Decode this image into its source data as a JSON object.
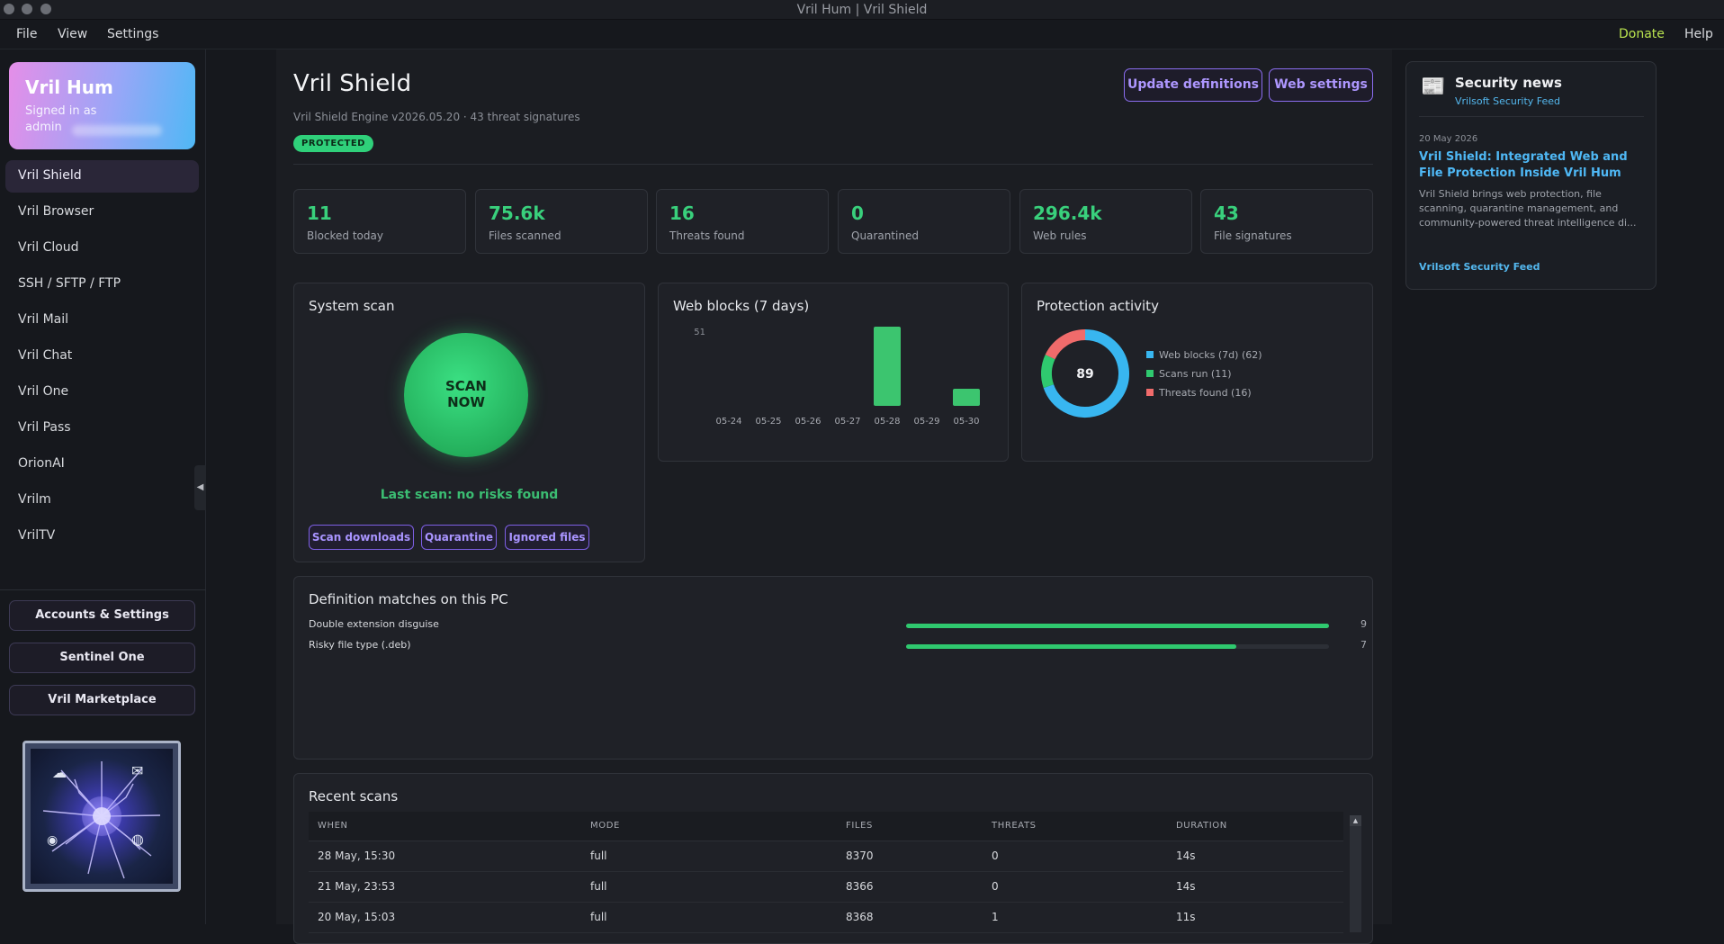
{
  "window": {
    "title": "Vril Hum | Vril Shield"
  },
  "menubar": {
    "file": "File",
    "view": "View",
    "settings": "Settings",
    "donate": "Donate",
    "help": "Help"
  },
  "profile": {
    "name": "Vril Hum",
    "signed_in": "Signed in as admin"
  },
  "sidebar": {
    "items": [
      {
        "label": "Vril Shield"
      },
      {
        "label": "Vril Browser"
      },
      {
        "label": "Vril Cloud"
      },
      {
        "label": "SSH / SFTP / FTP"
      },
      {
        "label": "Vril Mail"
      },
      {
        "label": "Vril Chat"
      },
      {
        "label": "Vril One"
      },
      {
        "label": "Vril Pass"
      },
      {
        "label": "OrionAI"
      },
      {
        "label": "Vrilm"
      },
      {
        "label": "VrilTV"
      }
    ],
    "buttons": {
      "accounts": "Accounts & Settings",
      "sentinel": "Sentinel One",
      "marketplace": "Vril Marketplace"
    }
  },
  "header": {
    "title": "Vril Shield",
    "engine": "Vril Shield Engine v2026.05.20 · 43 threat signatures",
    "status": "PROTECTED",
    "update_btn": "Update definitions",
    "web_btn": "Web settings"
  },
  "stats": [
    {
      "value": "11",
      "label": "Blocked today"
    },
    {
      "value": "75.6k",
      "label": "Files scanned"
    },
    {
      "value": "16",
      "label": "Threats found"
    },
    {
      "value": "0",
      "label": "Quarantined"
    },
    {
      "value": "296.4k",
      "label": "Web rules"
    },
    {
      "value": "43",
      "label": "File signatures"
    }
  ],
  "system_scan": {
    "title": "System scan",
    "scan_line1": "SCAN",
    "scan_line2": "NOW",
    "last_scan": "Last scan: no risks found",
    "scan_downloads": "Scan downloads",
    "quarantine": "Quarantine",
    "ignored": "Ignored files"
  },
  "web_blocks": {
    "title": "Web blocks (7 days)"
  },
  "protection": {
    "title": "Protection activity",
    "center": "89",
    "legend": [
      {
        "label": "Web blocks (7d) (62)",
        "color": "#38b6f0"
      },
      {
        "label": "Scans run (11)",
        "color": "#2fc96f"
      },
      {
        "label": "Threats found (16)",
        "color": "#f06b6b"
      }
    ]
  },
  "chart_data": [
    {
      "type": "bar",
      "categories": [
        "05-24",
        "05-25",
        "05-26",
        "05-27",
        "05-28",
        "05-29",
        "05-30"
      ],
      "values": [
        0,
        0,
        0,
        0,
        51,
        0,
        11
      ],
      "ymax_label": "51",
      "color": "#3cc56f"
    },
    {
      "type": "pie",
      "labels": [
        "Web blocks (7d)",
        "Scans run",
        "Threats found"
      ],
      "values": [
        62,
        11,
        16
      ],
      "colors": [
        "#38b6f0",
        "#2fc96f",
        "#f06b6b"
      ],
      "center_label": "89"
    }
  ],
  "matches": {
    "title": "Definition matches on this PC",
    "rows": [
      {
        "label": "Double extension disguise",
        "count": "9",
        "ratio": 1.0
      },
      {
        "label": "Risky file type (.deb)",
        "count": "7",
        "ratio": 0.78
      }
    ]
  },
  "recent": {
    "title": "Recent scans",
    "headers": {
      "when": "WHEN",
      "mode": "MODE",
      "files": "FILES",
      "threats": "THREATS",
      "duration": "DURATION"
    },
    "rows": [
      {
        "when": "28 May, 15:30",
        "mode": "full",
        "files": "8370",
        "threats": "0",
        "duration": "14s"
      },
      {
        "when": "21 May, 23:53",
        "mode": "full",
        "files": "8366",
        "threats": "0",
        "duration": "14s"
      },
      {
        "when": "20 May, 15:03",
        "mode": "full",
        "files": "8368",
        "threats": "1",
        "duration": "11s"
      }
    ]
  },
  "news": {
    "title": "Security news",
    "feed": "Vrilsoft Security Feed",
    "date": "20 May 2026",
    "headline": "Vril Shield: Integrated Web and File Protection Inside Vril Hum",
    "excerpt": "Vril Shield brings web protection, file scanning, quarantine management, and community-powered threat intelligence di...",
    "source": "Vrilsoft Security Feed"
  }
}
